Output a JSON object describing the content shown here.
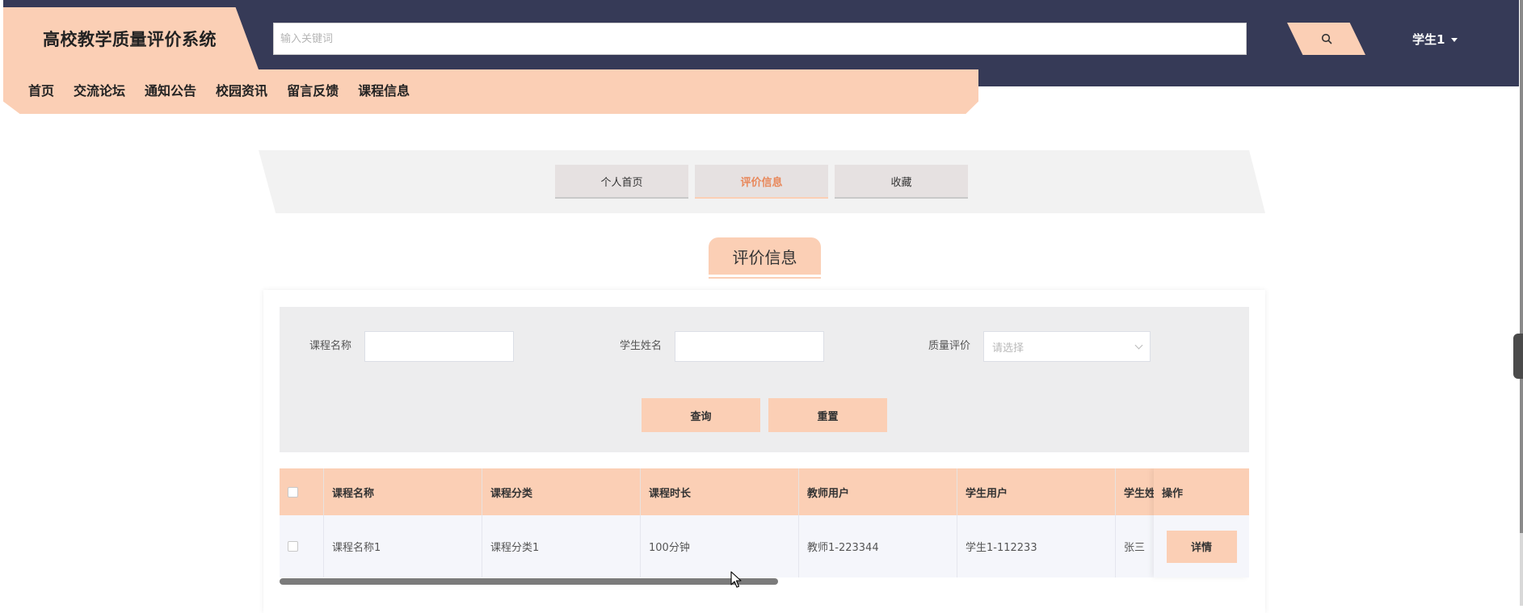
{
  "header": {
    "brand_title": "高校教学质量评价系统",
    "search_placeholder": "输入关键词",
    "search_icon": "search-icon",
    "user_label": "学生1"
  },
  "nav": {
    "items": [
      "首页",
      "交流论坛",
      "通知公告",
      "校园资讯",
      "留言反馈",
      "课程信息"
    ]
  },
  "tabs": {
    "items": [
      {
        "label": "个人首页",
        "active": false
      },
      {
        "label": "评价信息",
        "active": true
      },
      {
        "label": "收藏",
        "active": false
      }
    ]
  },
  "section": {
    "title": "评价信息"
  },
  "filters": {
    "course_name_label": "课程名称",
    "course_name_value": "",
    "student_name_label": "学生姓名",
    "student_name_value": "",
    "quality_label": "质量评价",
    "quality_placeholder": "请选择",
    "query_button": "查询",
    "reset_button": "重置"
  },
  "table": {
    "columns": [
      "课程名称",
      "课程分类",
      "课程时长",
      "教师用户",
      "学生用户",
      "学生姓名"
    ],
    "operation_column": "操作",
    "rows": [
      {
        "cells": [
          "课程名称1",
          "课程分类1",
          "100分钟",
          "教师1-223344",
          "学生1-112233",
          "张三"
        ],
        "action_label": "详情"
      }
    ]
  },
  "colors": {
    "accent": "#fbcfb5",
    "header_bg": "#363a57",
    "active_tab_text": "#e8885b"
  }
}
